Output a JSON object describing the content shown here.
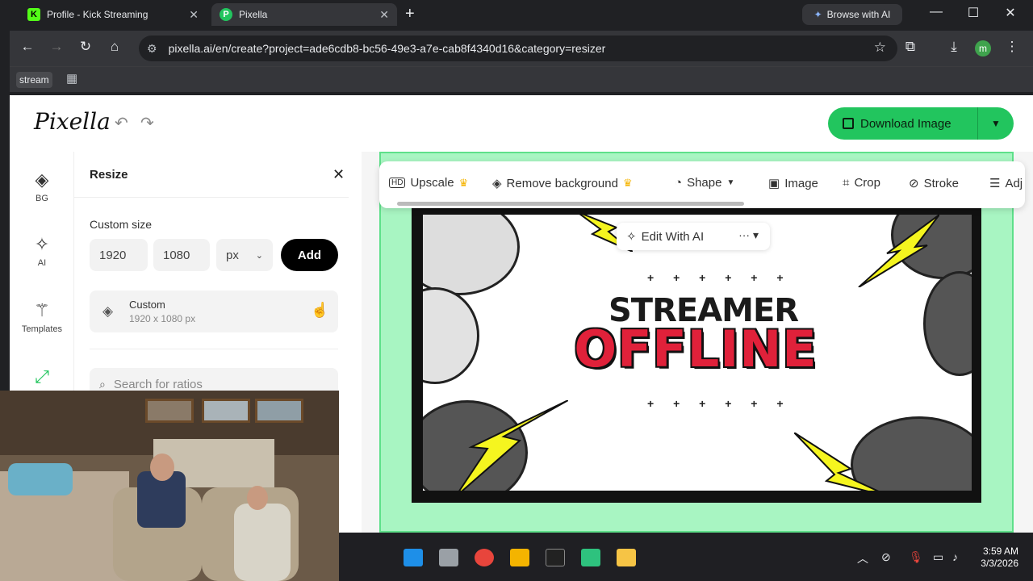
{
  "browser": {
    "tabs": [
      {
        "title": "Profile - Kick Streaming",
        "favicon": "K",
        "active": false
      },
      {
        "title": "Pixella",
        "favicon": "P",
        "active": true
      }
    ],
    "browse_ai": "Browse with AI",
    "url": "pixella.ai/en/create?project=ade6cdb8-bc56-49e3-a7e-cab8f4340d16&category=resizer",
    "profile_initial": "m",
    "bookmarks": [
      "stream"
    ]
  },
  "app": {
    "logo": "Pixella",
    "download_label": "Download Image",
    "accent": "#22c55e"
  },
  "leftnav": [
    {
      "label": "BG",
      "icon": "layers-icon"
    },
    {
      "label": "AI",
      "icon": "sparkle-icon"
    },
    {
      "label": "Templates",
      "icon": "magic-wand-icon"
    },
    {
      "label": "",
      "icon": "resize-icon"
    }
  ],
  "resize_panel": {
    "title": "Resize",
    "custom_size_label": "Custom size",
    "width": "1920",
    "height": "1080",
    "unit": "px",
    "add_label": "Add",
    "preset": {
      "name": "Custom",
      "dims": "1920 x 1080 px"
    },
    "search_placeholder": "Search for ratios"
  },
  "canvas_toolbar": {
    "upscale": "Upscale",
    "remove_bg": "Remove background",
    "shape": "Shape",
    "image": "Image",
    "crop": "Crop",
    "stroke": "Stroke",
    "adjust": "Adj",
    "edit_ai": "Edit With AI"
  },
  "artwork": {
    "line1": "STREAMER",
    "line2": "OFFLINE",
    "plus_row": "+ + + + + +"
  },
  "taskbar": {
    "time": "3:59 AM",
    "date": "3/3/2026"
  }
}
